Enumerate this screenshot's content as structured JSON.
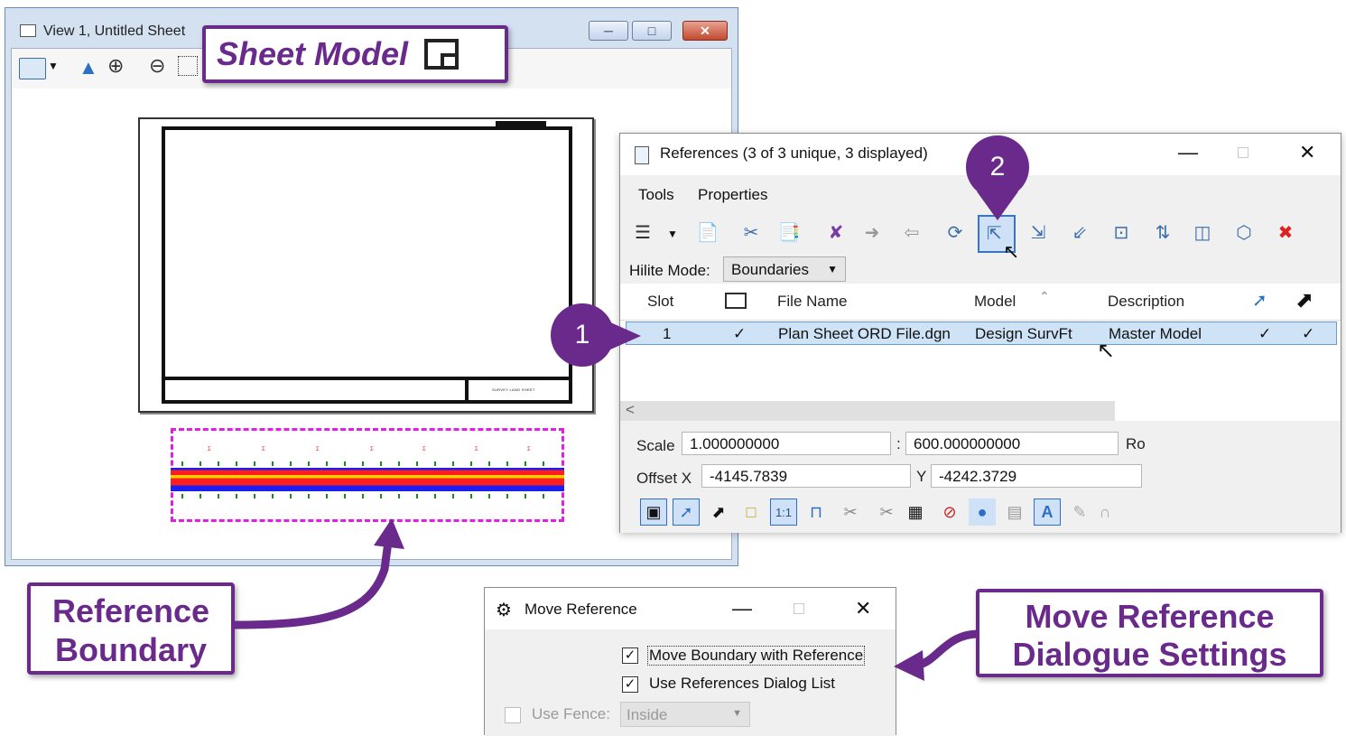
{
  "view_window": {
    "title": "View 1, Untitled Sheet",
    "sheet_tb_text": "SURVEY LAND SHEET"
  },
  "callouts": {
    "sheet_model": "Sheet Model",
    "reference_boundary_line1": "Reference",
    "reference_boundary_line2": "Boundary",
    "move_settings_line1": "Move Reference",
    "move_settings_line2": "Dialogue Settings"
  },
  "badges": {
    "one": "1",
    "two": "2"
  },
  "references": {
    "title": "References (3 of 3 unique, 3 displayed)",
    "menu": [
      "Tools",
      "Properties"
    ],
    "hilite_label": "Hilite Mode:",
    "hilite_value": "Boundaries",
    "columns": [
      "Slot",
      "File Name",
      "Model",
      "Description"
    ],
    "rows": [
      {
        "slot": "1",
        "display": "✓",
        "file": "Plan Sheet ORD File.dgn",
        "model": "Design SurvFt",
        "description": "Master Model",
        "snap": "✓",
        "locate": "✓"
      }
    ],
    "scale_label": "Scale",
    "scale_a": "1.000000000",
    "scale_sep": ":",
    "scale_b": "600.000000000",
    "ro_label": "Ro",
    "offset_label": "Offset X",
    "offset_x": "-4145.7839",
    "y_label": "Y",
    "offset_y": "-4242.3729",
    "scale_btn": "1:1"
  },
  "move_reference": {
    "title": "Move Reference",
    "opt1": "Move Boundary with Reference",
    "opt2": "Use References Dialog List",
    "opt3": "Use Fence:",
    "fence_value": "Inside",
    "check": "✓"
  },
  "colors": {
    "accent": "#6a2a8c",
    "boundary": "#e01ee6",
    "selection": "#cfe3f7"
  }
}
